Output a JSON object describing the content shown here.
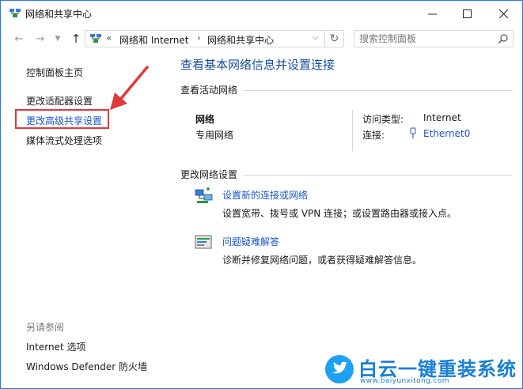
{
  "window": {
    "title": "网络和共享中心"
  },
  "address_bar": {
    "separator": "«",
    "crumbs": [
      "网络和 Internet",
      "网络和共享中心"
    ],
    "crumb_separator": "›"
  },
  "search": {
    "placeholder": "搜索控制面板"
  },
  "left_pane": {
    "home": "控制面板主页",
    "adapter_settings": "更改适配器设置",
    "advanced_sharing": "更改高级共享设置",
    "media_streaming": "媒体流式处理选项",
    "see_also_heading": "另请参阅",
    "internet_options": "Internet 选项",
    "defender_firewall": "Windows Defender 防火墙"
  },
  "main": {
    "title": "查看基本网络信息并设置连接",
    "active_networks_heading": "查看活动网络",
    "network": {
      "name": "网络",
      "type": "专用网络",
      "access_type_label": "访问类型:",
      "access_type_value": "Internet",
      "connections_label": "连接:",
      "connection_value": "Ethernet0"
    },
    "change_settings_heading": "更改网络设置",
    "tasks": [
      {
        "link": "设置新的连接或网络",
        "desc": "设置宽带、拨号或 VPN 连接；或设置路由器或接入点。"
      },
      {
        "link": "问题疑难解答",
        "desc": "诊断并修复网络问题，或者获得疑难解答信息。"
      }
    ]
  },
  "watermark": {
    "brand": "白云一键重装系统",
    "url": "www.baiyunxitong.com"
  },
  "colors": {
    "link": "#1a56c8",
    "title_blue": "#1a4fa0",
    "highlight_red": "#e03a3a",
    "window_border": "#2b79d8"
  }
}
